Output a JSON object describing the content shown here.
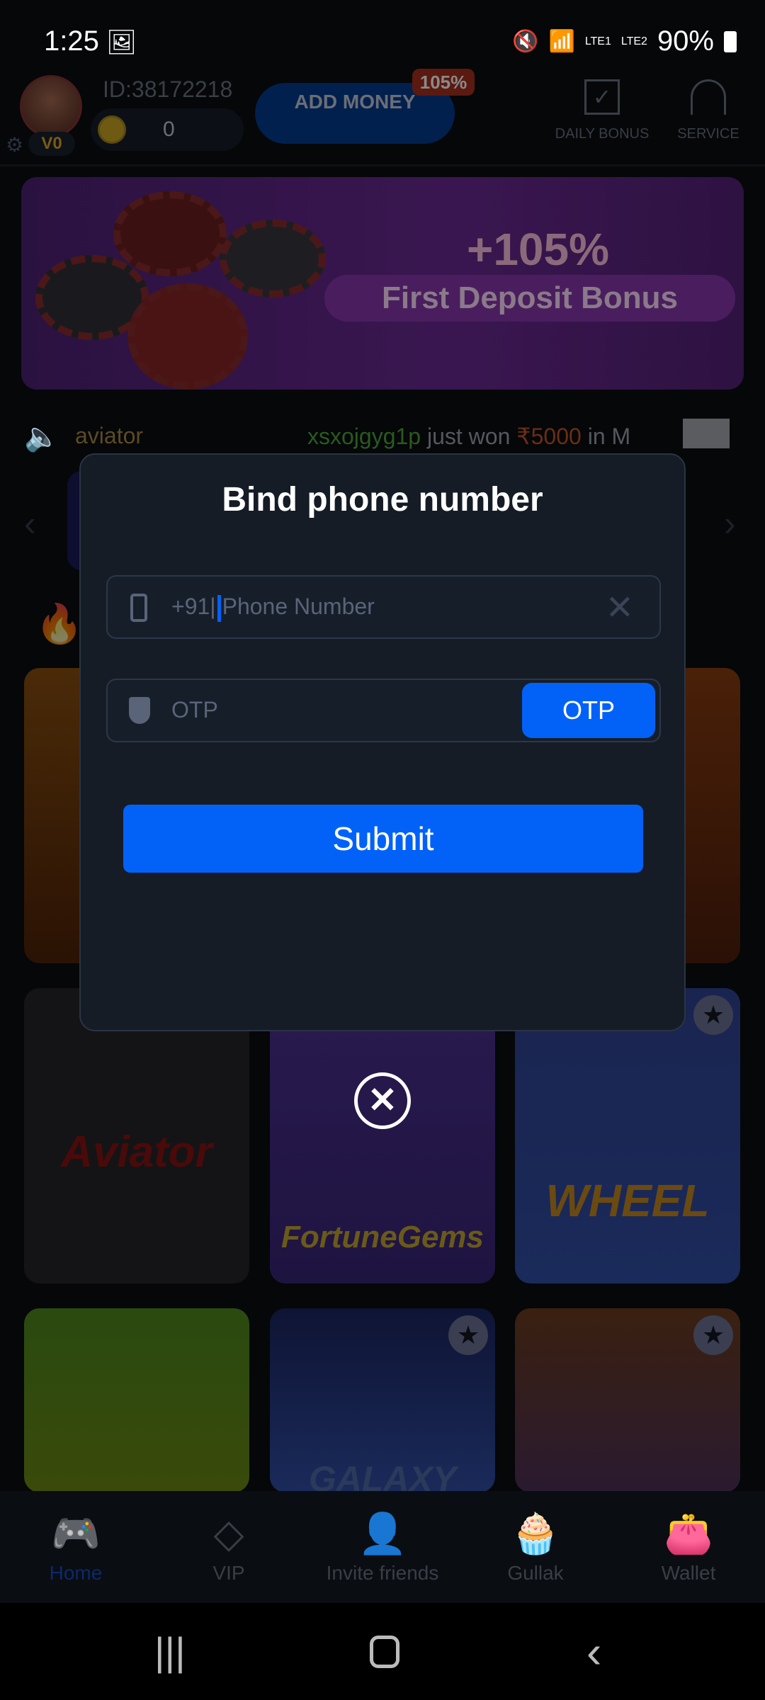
{
  "status_bar": {
    "time": "1:25",
    "battery": "90%",
    "sim1": "LTE1",
    "sim2": "LTE2"
  },
  "header": {
    "user_id": "ID:38172218",
    "vip_level": "V0",
    "balance": "0",
    "add_money": "ADD MONEY",
    "bonus_badge": "105%",
    "daily_bonus": "DAILY BONUS",
    "service": "SERVICE"
  },
  "banner": {
    "headline": "+105%",
    "subtitle": "First Deposit Bonus"
  },
  "ticker": {
    "game": "aviator",
    "user": "xsxojgyg1p",
    "message": "just won",
    "amount": "₹5000",
    "suffix": "in M"
  },
  "games": [
    {
      "name": "Aviator"
    },
    {
      "name": "FortuneGems"
    },
    {
      "name": "WHEEL"
    },
    {
      "name": "GALAXY"
    }
  ],
  "modal": {
    "title": "Bind phone number",
    "country_code": "+91|",
    "phone_placeholder": "Phone Number",
    "otp_placeholder": "OTP",
    "otp_button": "OTP",
    "submit": "Submit"
  },
  "bottom_nav": [
    {
      "label": "Home",
      "active": true
    },
    {
      "label": "VIP"
    },
    {
      "label": "Invite friends"
    },
    {
      "label": "Gullak"
    },
    {
      "label": "Wallet"
    }
  ],
  "colors": {
    "accent": "#0262f8",
    "modal_bg": "#151c26"
  }
}
